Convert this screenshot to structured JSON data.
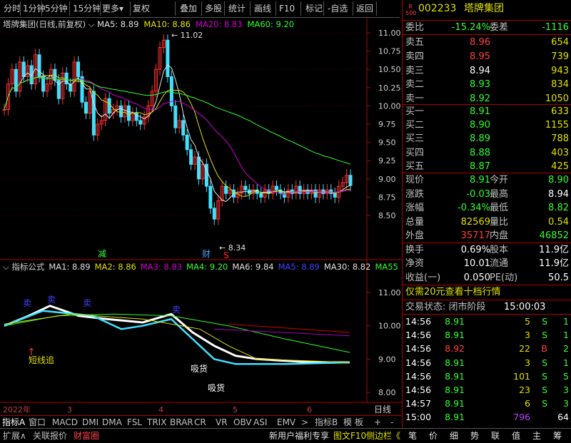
{
  "toolbar": {
    "items": [
      "分时",
      "1分钟",
      "5分钟",
      "15分钟",
      "更多",
      "复权",
      "叠加",
      "多股",
      "统计",
      "画线",
      "F10",
      "标记",
      "-自选",
      "返回"
    ]
  },
  "main_chart": {
    "title": "塔牌集团(日线,前复权)",
    "ma": [
      {
        "label": "MA5: 8.89",
        "color": "#e0e0e0"
      },
      {
        "label": "MA10: 8.86",
        "color": "#e0e000"
      },
      {
        "label": "MA20: 8.83",
        "color": "#d000d0"
      },
      {
        "label": "MA60: 9.20",
        "color": "#30ff30"
      }
    ],
    "high_label": "11.02",
    "low_label": "8.34",
    "y_ticks": [
      "11.00",
      "10.75",
      "10.50",
      "10.25",
      "10.00",
      "9.75",
      "9.50",
      "9.25",
      "9.00",
      "8.75",
      "8.50"
    ],
    "marks": {
      "jian": "减",
      "cai": "财",
      "s": "S"
    }
  },
  "indicator_chart": {
    "title": "指标公式",
    "ma": [
      {
        "label": "MA1: 8.89",
        "color": "#e0e0e0"
      },
      {
        "label": "MA2: 8.86",
        "color": "#e0e000"
      },
      {
        "label": "MA3: 8.83",
        "color": "#d000d0"
      },
      {
        "label": "MA4: 9.20",
        "color": "#30ff30"
      },
      {
        "label": "MA6: 9.84",
        "color": "#e0e0e0"
      },
      {
        "label": "MA5: 8.89",
        "color": "#4040ff"
      },
      {
        "label": "MA30: 8.82",
        "color": "#e0e0e0"
      },
      {
        "label": "MA55",
        "color": "#30ff30"
      }
    ],
    "y_ticks": [
      "11.00",
      "10.00",
      "9.00",
      "8.00"
    ],
    "annotations": {
      "mai_sell": "卖",
      "short_chase": "短线追",
      "xi_huo": "吸货"
    }
  },
  "x_axis": {
    "labels": [
      "2022年",
      "3",
      "4",
      "5",
      "6"
    ],
    "period": "日线"
  },
  "bottom_tabs": [
    "指标A",
    "窗口",
    "MACD",
    "DMI",
    "DMA",
    "FSL",
    "TRIX",
    "BRAR",
    "CR",
    "VR",
    "OBV",
    "ASI",
    "EMV",
    ">",
    "指标B",
    "模",
    "板",
    "+",
    "-"
  ],
  "status_bar": {
    "left": [
      "扩展∧",
      "关联报价",
      "财富圈"
    ],
    "promo": "新用户福利专享",
    "f10": "图文F10",
    "sidebar": "侧边栏《",
    "right": [
      "笔",
      "价",
      "细",
      "势",
      "联",
      "值",
      "主",
      "筹"
    ]
  },
  "quote": {
    "code": "002233",
    "name": "塔牌集团",
    "wei_bi_label": "委比",
    "wei_bi": "-15.24%",
    "wei_cha_label": "委差",
    "wei_cha": "-1116",
    "asks": [
      {
        "label": "卖五",
        "price": "8.96",
        "vol": "654",
        "color": "#ff4040"
      },
      {
        "label": "卖四",
        "price": "8.95",
        "vol": "739",
        "color": "#ff4040"
      },
      {
        "label": "卖三",
        "price": "8.94",
        "vol": "943",
        "color": "#ffffff"
      },
      {
        "label": "卖二",
        "price": "8.93",
        "vol": "834",
        "color": "#30ff30"
      },
      {
        "label": "卖一",
        "price": "8.92",
        "vol": "1050",
        "color": "#30ff30"
      }
    ],
    "bids": [
      {
        "label": "买一",
        "price": "8.91",
        "vol": "633",
        "color": "#30ff30"
      },
      {
        "label": "买二",
        "price": "8.90",
        "vol": "1155",
        "color": "#30ff30"
      },
      {
        "label": "买三",
        "price": "8.89",
        "vol": "788",
        "color": "#30ff30"
      },
      {
        "label": "买四",
        "price": "8.88",
        "vol": "403",
        "color": "#30ff30"
      },
      {
        "label": "买五",
        "price": "8.87",
        "vol": "425",
        "color": "#30ff30"
      }
    ],
    "stats": [
      {
        "l1": "现价",
        "v1": "8.91",
        "c1": "#30ff30",
        "l2": "今开",
        "v2": "8.90",
        "c2": "#30ff30"
      },
      {
        "l1": "涨跌",
        "v1": "-0.03",
        "c1": "#30ff30",
        "l2": "最高",
        "v2": "8.94",
        "c2": "#ffffff"
      },
      {
        "l1": "涨幅",
        "v1": "-0.34%",
        "c1": "#30ff30",
        "l2": "最低",
        "v2": "8.82",
        "c2": "#30ff30"
      },
      {
        "l1": "总量",
        "v1": "82569",
        "c1": "#e0e000",
        "l2": "量比",
        "v2": "0.54",
        "c2": "#e0e000"
      },
      {
        "l1": "外盘",
        "v1": "35717",
        "c1": "#ff4040",
        "l2": "内盘",
        "v2": "46852",
        "c2": "#30ff30"
      }
    ],
    "stats2": [
      {
        "l1": "换手",
        "v1": "0.69%",
        "l2": "股本",
        "v2": "11.9亿"
      },
      {
        "l1": "净资",
        "v1": "10.01",
        "l2": "流通",
        "v2": "11.9亿"
      },
      {
        "l1": "收益(一)",
        "v1": "0.050",
        "l2": "PE(动)",
        "v2": "50.5"
      }
    ],
    "promo": "仅需20元查看十档行情",
    "promo_highlight": "20",
    "trade_status_label": "交易状态: 闭市阶段",
    "trade_time": "15:00:03",
    "ticks": [
      {
        "time": "14:56",
        "price": "8.91",
        "vol": "5",
        "side": "S"
      },
      {
        "time": "14:56",
        "price": "8.91",
        "vol": "3",
        "side": "S"
      },
      {
        "time": "14:56",
        "price": "8.92",
        "vol": "22",
        "side": "B"
      },
      {
        "time": "14:56",
        "price": "8.91",
        "vol": "3",
        "side": "S"
      },
      {
        "time": "14:56",
        "price": "8.91",
        "vol": "101",
        "side": "S"
      },
      {
        "time": "14:56",
        "price": "8.91",
        "vol": "23",
        "side": "S"
      },
      {
        "time": "14:57",
        "price": "8.91",
        "vol": "6",
        "side": "S"
      },
      {
        "time": "15:00",
        "price": "8.91",
        "vol": "796",
        "side": ""
      }
    ],
    "tick_counts": [
      "1",
      "1",
      "2",
      "1",
      "5",
      "3",
      "3",
      "64"
    ]
  }
}
